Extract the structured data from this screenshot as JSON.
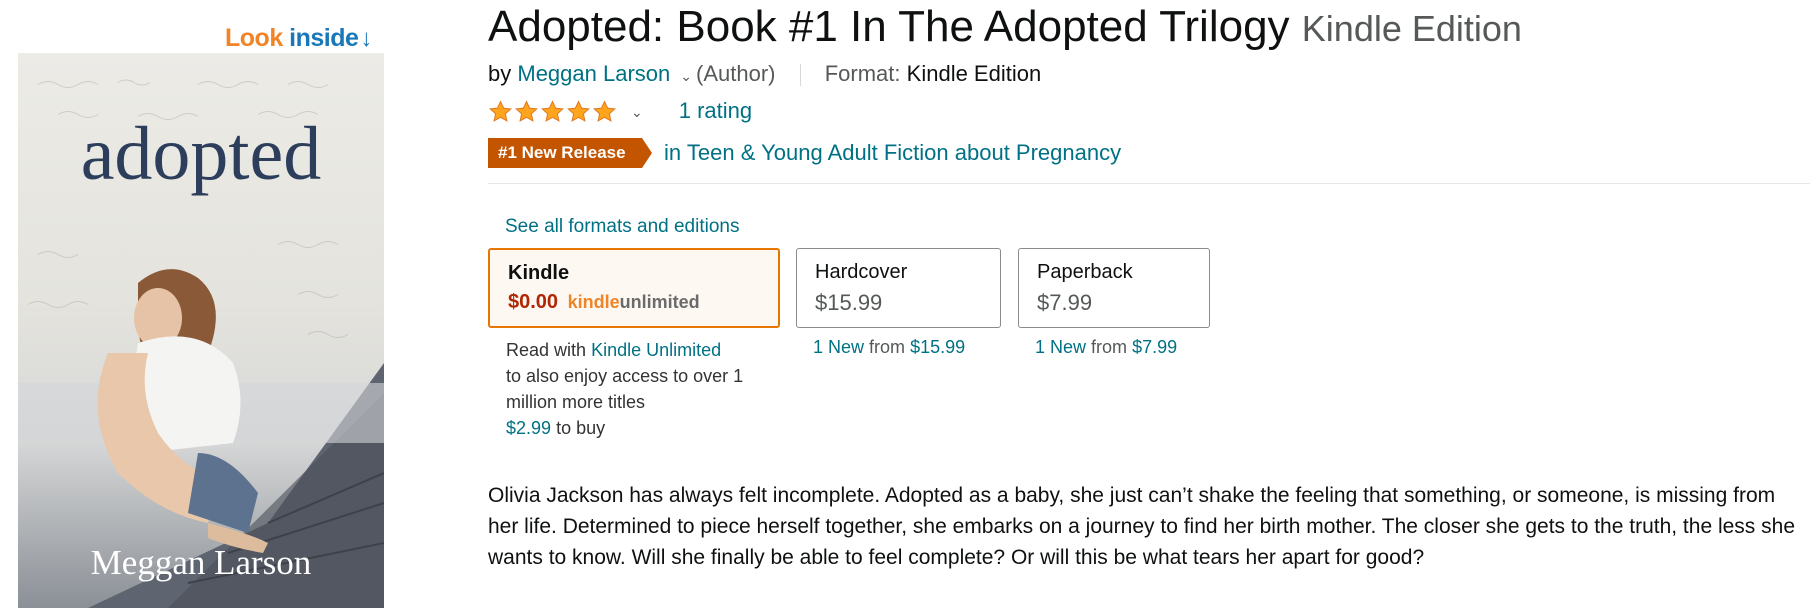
{
  "look_inside": {
    "word1": "Look",
    "word2": "inside",
    "arrow": "↓"
  },
  "cover": {
    "title": "adopted",
    "author": "Meggan Larson"
  },
  "product": {
    "title": "Adopted: Book #1 In The Adopted Trilogy",
    "edition": "Kindle Edition",
    "by": "by",
    "author": "Meggan Larson",
    "author_role": "(Author)",
    "format_label": "Format:",
    "format_value": "Kindle Edition",
    "stars": 5,
    "rating_count": "1 rating",
    "badge": "#1 New Release",
    "badge_category": "in Teen & Young Adult Fiction about Pregnancy"
  },
  "formats": {
    "see_all": "See all formats and editions",
    "kindle": {
      "name": "Kindle",
      "price": "$0.00",
      "ku_kindle": "kindle",
      "ku_unlimited": "unlimited"
    },
    "hardcover": {
      "name": "Hardcover",
      "price": "$15.99",
      "new_count": "1 New",
      "from": "from",
      "from_price": "$15.99"
    },
    "paperback": {
      "name": "Paperback",
      "price": "$7.99",
      "new_count": "1 New",
      "from": "from",
      "from_price": "$7.99"
    },
    "kindle_info": {
      "read_with": "Read with",
      "ku_link": "Kindle Unlimited",
      "line2": "to also enjoy access to over 1",
      "line3": "million more titles",
      "buy_price": "$2.99",
      "buy_suffix": "to buy"
    }
  },
  "description": "Olivia Jackson has always felt incomplete. Adopted as a baby, she just can’t shake the feeling that something, or someone, is missing from her life. Determined to piece herself together, she embarks on a journey to find her birth mother. The closer she gets to the truth, the less she wants to know. Will she finally be able to feel complete? Or will this be what tears her apart for good?",
  "colors": {
    "link": "#007185",
    "price_red": "#b12704",
    "badge": "#c45500",
    "selected_border": "#e77600",
    "star": "#ffa41c"
  }
}
